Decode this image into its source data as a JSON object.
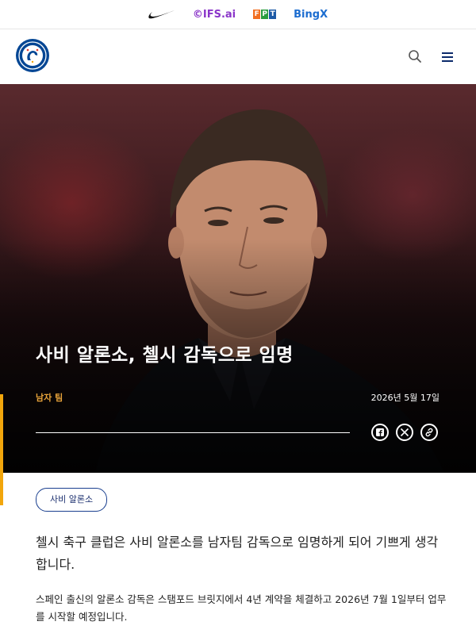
{
  "sponsors": {
    "nike": "Nike",
    "ifs": "©IFS.ai",
    "fpt_letters": [
      "F",
      "P",
      "T"
    ],
    "fpt_colors": [
      "#f26f21",
      "#2a9d3f",
      "#1d5aa6"
    ],
    "bingx": "BingX"
  },
  "header": {
    "crest_icon": "chelsea-crest-icon",
    "search_icon": "search-icon",
    "menu_icon": "hamburger-menu-icon"
  },
  "hero": {
    "headline": "사비 알론소, 첼시 감독으로 임명",
    "category": "남자 팀",
    "date": "2026년 5월 17일",
    "share_icons": [
      "facebook-icon",
      "x-icon",
      "link-icon"
    ],
    "accent_color": "#f2a60c"
  },
  "article": {
    "tag": "사비 알론소",
    "lead": "첼시 축구 클럽은 사비 알론소를 남자팀 감독으로 임명하게 되어 기쁘게 생각합니다.",
    "body": "스페인 출신의 알론소 감독은 스탬포드 브릿지에서 4년 계약을 체결하고 2026년 7월 1일부터 업무를 시작할 예정입니다."
  },
  "colors": {
    "brand_blue": "#034694",
    "tag_border": "#1a3f8f",
    "category_gold": "#e8a33a"
  }
}
